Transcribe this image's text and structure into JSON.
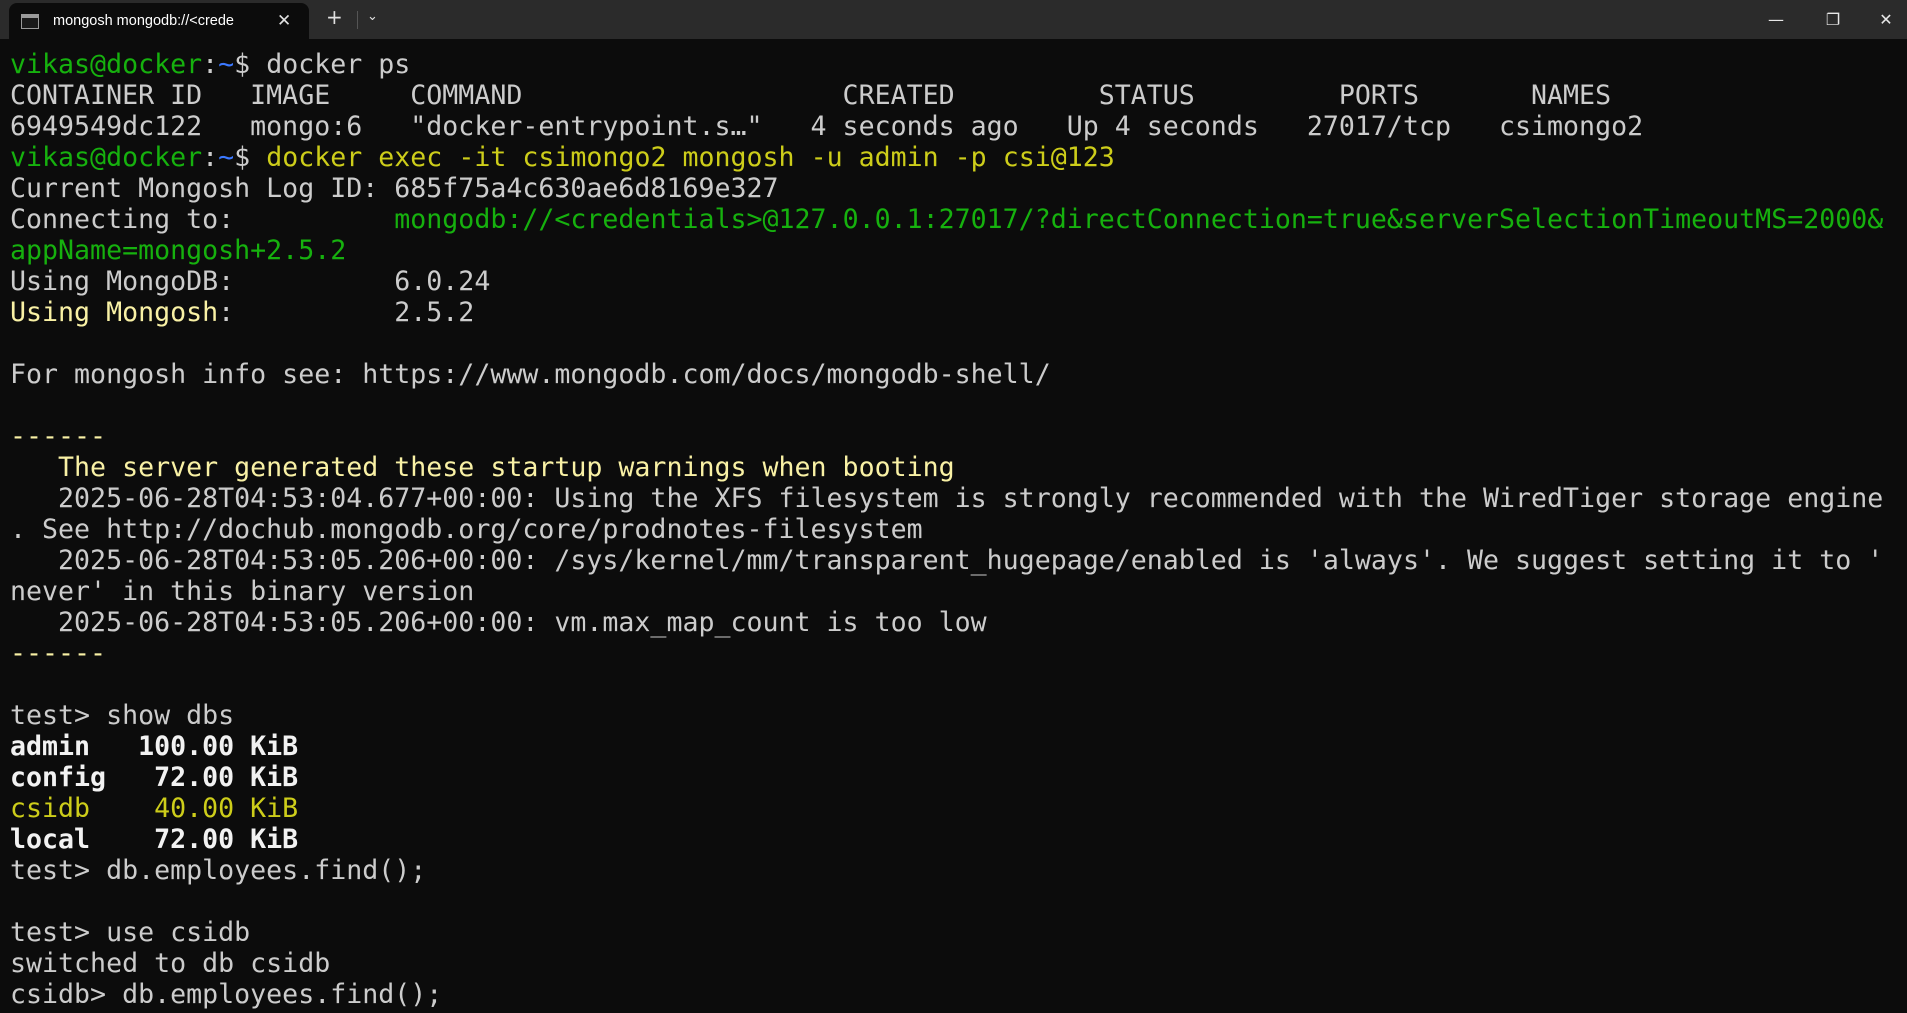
{
  "window": {
    "tab_title": "mongosh mongodb://<crede",
    "close_tab": "✕",
    "new_tab": "+",
    "dropdown": "⌄",
    "minimize": "—",
    "maximize": "❐",
    "close": "✕"
  },
  "colors": {
    "fg": "#cccccc",
    "white": "#f2f2f2",
    "green": "#16b10e",
    "blue": "#3b78ff",
    "yellow": "#cdcd1a",
    "lightyellow": "#f9f1a5"
  },
  "terminal": {
    "lines": [
      [
        {
          "t": "vikas@docker",
          "c": "green"
        },
        {
          "t": ":",
          "c": "fg"
        },
        {
          "t": "~",
          "c": "blue"
        },
        {
          "t": "$ docker ps",
          "c": "fg"
        }
      ],
      [
        {
          "t": "CONTAINER ID   IMAGE     COMMAND                    CREATED         STATUS         PORTS       NAMES",
          "c": "fg"
        }
      ],
      [
        {
          "t": "6949549dc122   mongo:6   \"docker-entrypoint.s…\"   4 seconds ago   Up 4 seconds   27017/tcp   csimongo2",
          "c": "fg"
        }
      ],
      [
        {
          "t": "vikas@docker",
          "c": "green"
        },
        {
          "t": ":",
          "c": "fg"
        },
        {
          "t": "~",
          "c": "blue"
        },
        {
          "t": "$ ",
          "c": "fg"
        },
        {
          "t": "docker exec -it csimongo2 mongosh -u admin -p csi@123",
          "c": "yellow"
        }
      ],
      [
        {
          "t": "Current Mongosh Log ID: 685f75a4c630ae6d8169e327",
          "c": "fg"
        }
      ],
      [
        {
          "t": "Connecting to:          ",
          "c": "fg"
        },
        {
          "t": "mongodb://<credentials>@127.0.0.1:27017/?directConnection=true&serverSelectionTimeoutMS=2000&",
          "c": "green"
        }
      ],
      [
        {
          "t": "appName=mongosh+2.5.2",
          "c": "green"
        }
      ],
      [
        {
          "t": "Using MongoDB:          6.0.24",
          "c": "fg"
        }
      ],
      [
        {
          "t": "Using Mongosh",
          "c": "lightyellow"
        },
        {
          "t": ":          2.5.2",
          "c": "fg"
        }
      ],
      [],
      [
        {
          "t": "For mongosh info see: https://www.mongodb.com/docs/mongodb-shell/",
          "c": "fg"
        }
      ],
      [],
      [
        {
          "t": "------",
          "c": "lightyellow"
        }
      ],
      [
        {
          "t": "   The server generated these startup warnings when booting",
          "c": "lightyellow"
        }
      ],
      [
        {
          "t": "   2025-06-28T04:53:04.677+00:00: Using the XFS filesystem is strongly recommended with the WiredTiger storage engine",
          "c": "fg"
        }
      ],
      [
        {
          "t": ". See http://dochub.mongodb.org/core/prodnotes-filesystem",
          "c": "fg"
        }
      ],
      [
        {
          "t": "   2025-06-28T04:53:05.206+00:00: /sys/kernel/mm/transparent_hugepage/enabled is 'always'. We suggest setting it to '",
          "c": "fg"
        }
      ],
      [
        {
          "t": "never' in this binary version",
          "c": "fg"
        }
      ],
      [
        {
          "t": "   2025-06-28T04:53:05.206+00:00: vm.max_map_count is too low",
          "c": "fg"
        }
      ],
      [
        {
          "t": "------",
          "c": "lightyellow"
        }
      ],
      [],
      [
        {
          "t": "test> show dbs",
          "c": "fg"
        }
      ],
      [
        {
          "t": "admin   100.00 KiB",
          "c": "white"
        }
      ],
      [
        {
          "t": "config   72.00 KiB",
          "c": "white"
        }
      ],
      [
        {
          "t": "csidb    40.00 KiB",
          "c": "yellow"
        }
      ],
      [
        {
          "t": "local    72.00 KiB",
          "c": "white"
        }
      ],
      [
        {
          "t": "test> db.employees.find();",
          "c": "fg"
        }
      ],
      [],
      [
        {
          "t": "test> use csidb",
          "c": "fg"
        }
      ],
      [
        {
          "t": "switched to db csidb",
          "c": "fg"
        }
      ],
      [
        {
          "t": "csidb> db.employees.find();",
          "c": "fg"
        }
      ]
    ]
  }
}
